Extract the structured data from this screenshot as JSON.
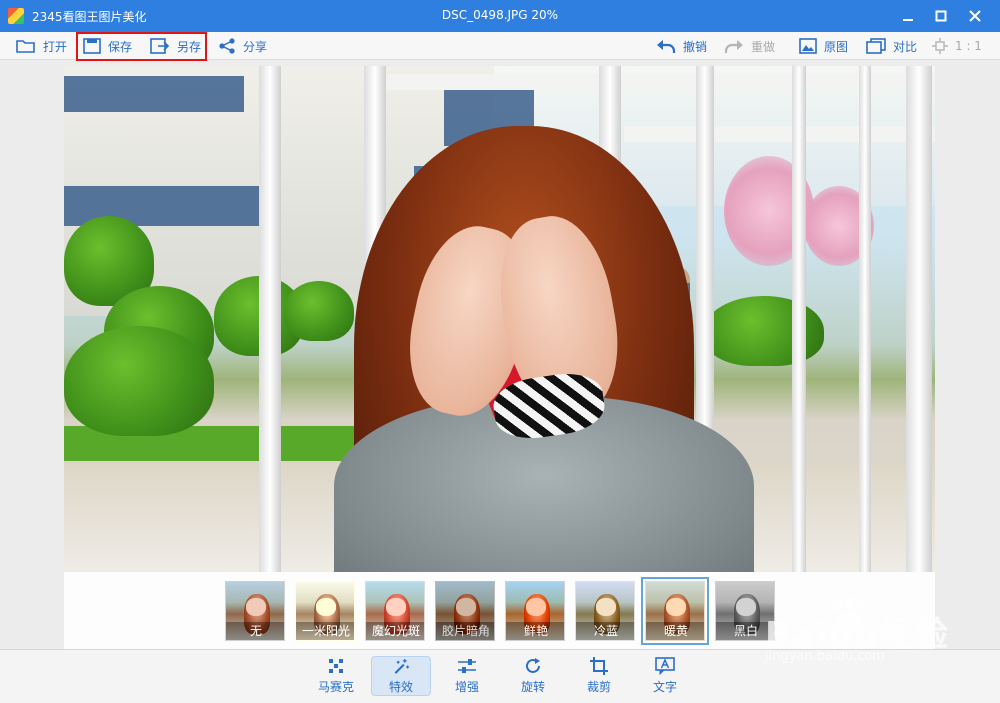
{
  "window": {
    "app_title": "2345看图王图片美化",
    "file_title": "DSC_0498.JPG  20%",
    "minimize_icon": "minimize-icon",
    "maximize_icon": "maximize-icon",
    "close_icon": "close-icon"
  },
  "toolbar": {
    "left": [
      {
        "label": "打开",
        "icon": "folder-open-icon"
      },
      {
        "label": "保存",
        "icon": "save-icon"
      },
      {
        "label": "另存",
        "icon": "save-as-icon"
      },
      {
        "label": "分享",
        "icon": "share-icon"
      }
    ],
    "right": [
      {
        "label": "撤销",
        "icon": "undo-icon",
        "enabled": true
      },
      {
        "label": "重做",
        "icon": "redo-icon",
        "enabled": false
      },
      {
        "label": "原图",
        "icon": "image-icon",
        "enabled": true
      },
      {
        "label": "对比",
        "icon": "compare-icon",
        "enabled": true
      },
      {
        "label": "1 : 1",
        "icon": "actual-size-icon",
        "enabled": false
      }
    ],
    "highlight_color": "#e01616"
  },
  "filters": {
    "items": [
      "无",
      "一米阳光",
      "魔幻光斑",
      "胶片暗角",
      "鲜艳",
      "冷蓝",
      "暖黄",
      "黑白"
    ],
    "selected": "暖黄"
  },
  "bottom_nav": {
    "items": [
      {
        "label": "马赛克",
        "icon": "mosaic-icon"
      },
      {
        "label": "特效",
        "icon": "magic-wand-icon"
      },
      {
        "label": "增强",
        "icon": "sliders-icon"
      },
      {
        "label": "旋转",
        "icon": "rotate-icon"
      },
      {
        "label": "裁剪",
        "icon": "crop-icon"
      },
      {
        "label": "文字",
        "icon": "text-icon"
      }
    ],
    "active": "特效"
  },
  "watermark": {
    "brand": "Baidu经验",
    "url": "jingyan.baidu.com"
  },
  "colors": {
    "titlebar": "#2f7fe0",
    "accent": "#2a6fc9",
    "selected_filter_border": "#4c9de8"
  }
}
